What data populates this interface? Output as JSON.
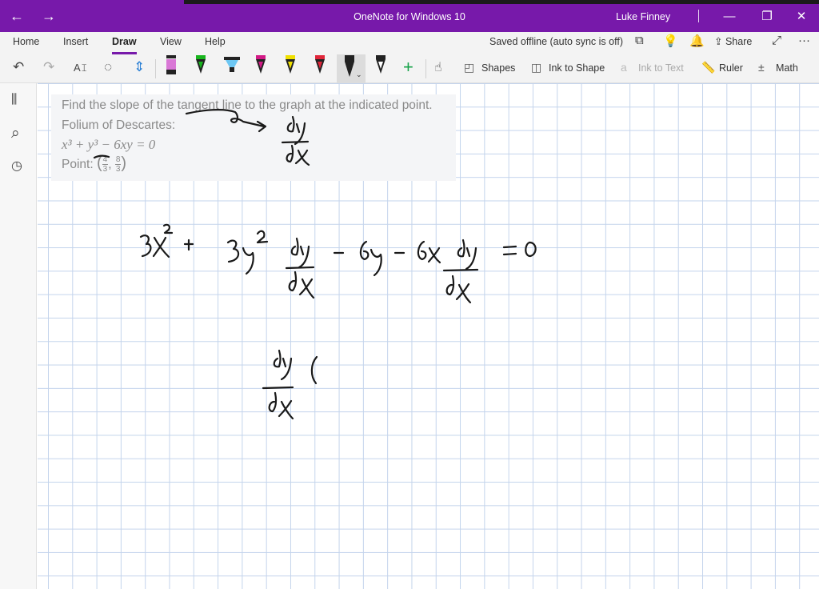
{
  "titlebar": {
    "back_icon": "←",
    "forward_icon": "→",
    "title": "OneNote for Windows 10",
    "user": "Luke Finney",
    "minimize_icon": "—",
    "restore_icon": "❐",
    "close_icon": "✕"
  },
  "ribbon": {
    "tabs": [
      "Home",
      "Insert",
      "Draw",
      "View",
      "Help"
    ],
    "active_tab": "Draw",
    "status": "Saved offline (auto sync is off)",
    "share_label": "Share",
    "more_icon": "···",
    "accent_color": "#7719aa"
  },
  "toolbar": {
    "undo_icon": "↶",
    "redo_icon": "↷",
    "type_icon": "A𝙸",
    "lasso_icon": "◌",
    "space_icon": "⇕",
    "add_icon": "+",
    "shapes_label": "Shapes",
    "ink_to_shape_label": "Ink to Shape",
    "ink_to_text_label": "Ink to Text",
    "ruler_label": "Ruler",
    "math_label": "Math",
    "pens": [
      {
        "color": "#d977d6",
        "kind": "highlighter"
      },
      {
        "color": "#18b51d",
        "kind": "pen"
      },
      {
        "color": "#6dc7f3",
        "kind": "highlighter"
      },
      {
        "color": "#d21a86",
        "kind": "pen"
      },
      {
        "color": "#f0e000",
        "kind": "pen"
      },
      {
        "color": "#e0263a",
        "kind": "pen"
      },
      {
        "color": "#222222",
        "kind": "pen-selected"
      },
      {
        "color": "#222222",
        "kind": "pen"
      }
    ]
  },
  "sidebar": {
    "notebooks_icon": "⫼",
    "search_icon": "⌕",
    "recent_icon": "◷"
  },
  "problem": {
    "line1": "Find the slope of the tangent line to the graph at the indicated point.",
    "line2": "Folium of Descartes:",
    "equation": "x³ + y³ − 6xy = 0",
    "point_label": "Point:",
    "point_x_num": "4",
    "point_x_den": "3",
    "point_y_num": "8",
    "point_y_den": "3"
  }
}
